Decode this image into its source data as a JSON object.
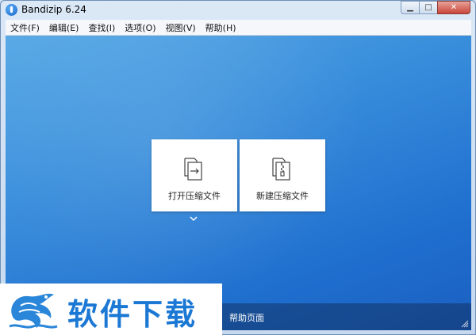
{
  "window": {
    "title": "Bandizip 6.24",
    "buttons": {
      "minimize": "▁",
      "maximize": "□",
      "close": "✕"
    }
  },
  "menu": [
    {
      "label": "文件(F)"
    },
    {
      "label": "编辑(E)"
    },
    {
      "label": "查找(I)"
    },
    {
      "label": "选项(O)"
    },
    {
      "label": "视图(V)"
    },
    {
      "label": "帮助(H)"
    }
  ],
  "cards": {
    "open": {
      "label": "打开压缩文件",
      "icon": "open-archive-icon"
    },
    "new": {
      "label": "新建压缩文件",
      "icon": "new-archive-icon"
    }
  },
  "bottom": {
    "help": "帮助页面"
  },
  "watermark": {
    "text": "软件下载"
  },
  "colors": {
    "accent": "#2a7fd6",
    "bottom_bar": "#1b3f73",
    "watermark_text": "#1b78d4"
  }
}
